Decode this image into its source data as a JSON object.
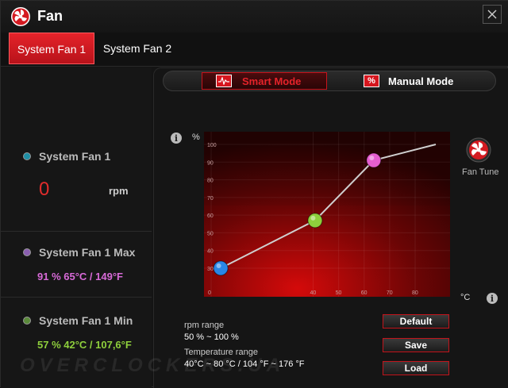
{
  "window": {
    "title": "Fan",
    "close_icon": "close-icon",
    "logo_icon": "fan-logo-icon"
  },
  "tabs": [
    {
      "label": "System Fan 1",
      "active": true
    },
    {
      "label": "System Fan 2",
      "active": false
    }
  ],
  "fans": [
    {
      "name": "System Fan 1",
      "value": "0",
      "unit": "rpm",
      "dot_color": "#1f8fa5"
    },
    {
      "name": "System Fan 1 Max",
      "stat": "91 %  65°C / 149°F",
      "dot_color": "#8a5fb0",
      "stat_color": "#d86ad8"
    },
    {
      "name": "System Fan 1 Min",
      "stat": "57 %  42°C / 107,6°F",
      "dot_color": "#5a8a3a",
      "stat_color": "#8ecf3c"
    }
  ],
  "modes": {
    "smart": {
      "label": "Smart Mode",
      "icon": "smart-mode-icon",
      "active": true
    },
    "manual": {
      "label": "Manual Mode",
      "icon": "percent-icon",
      "icon_text": "%",
      "active": false
    }
  },
  "chart_data": {
    "type": "line",
    "y_unit": "%",
    "x_unit": "°C",
    "xlim": [
      0,
      100
    ],
    "ylim": [
      0,
      100
    ],
    "x_ticks": [
      0,
      40,
      50,
      60,
      70,
      80
    ],
    "y_ticks": [
      30,
      40,
      50,
      60,
      70,
      80,
      90,
      100
    ],
    "x_tick_labels": [
      "0",
      "40",
      "50",
      "60",
      "70",
      "80"
    ],
    "y_tick_labels": [
      "30",
      "40",
      "50",
      "60",
      "70",
      "80",
      "90",
      "100"
    ],
    "curve": [
      {
        "x": 5,
        "y": 30
      },
      {
        "x": 42,
        "y": 57
      },
      {
        "x": 65,
        "y": 91
      },
      {
        "x": 100,
        "y": 100
      }
    ],
    "handles": [
      {
        "x": 5,
        "y": 30,
        "color": "#2a86e6"
      },
      {
        "x": 42,
        "y": 57,
        "color": "#8ecf3c"
      },
      {
        "x": 65,
        "y": 91,
        "color": "#e55fd0"
      }
    ],
    "grid": true
  },
  "fan_tune": {
    "label": "Fan Tune",
    "icon": "fan-tune-icon"
  },
  "info_icon_text": "i",
  "ranges": {
    "rpm_label": "rpm range",
    "rpm_value": "50 % ~ 100 %",
    "temp_label": "Temperature range",
    "temp_value": "40°C ~ 80 °C / 104 °F ~ 176 °F"
  },
  "buttons": {
    "default": "Default",
    "save": "Save",
    "load": "Load"
  },
  "watermark": "OVERCLOCKERS.UA",
  "colors": {
    "accent": "#e5232a"
  }
}
